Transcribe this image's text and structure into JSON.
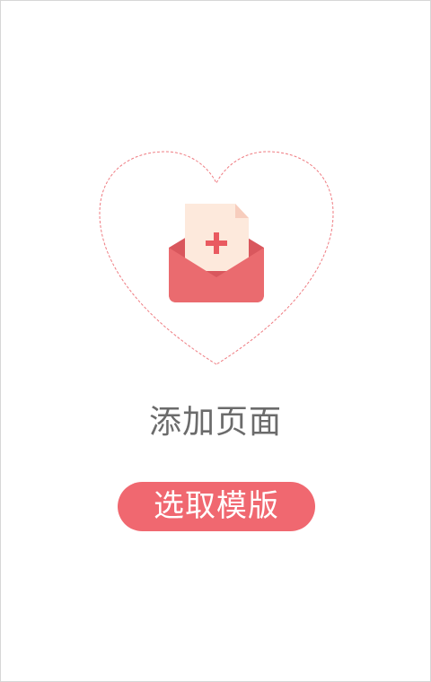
{
  "add_page": {
    "title": "添加页面",
    "icon": "envelope-document-plus-icon",
    "outline_icon": "heart-outline"
  },
  "actions": {
    "select_template_label": "选取模版"
  },
  "colors": {
    "accent": "#f06870",
    "heart_outline": "#ef7c82",
    "envelope": "#ea6b6f",
    "document": "#fde9dc",
    "document_fold": "#f7cdbd",
    "plus": "#e95a60",
    "title_text": "#6b6b6b",
    "border": "#d6d6d6"
  }
}
